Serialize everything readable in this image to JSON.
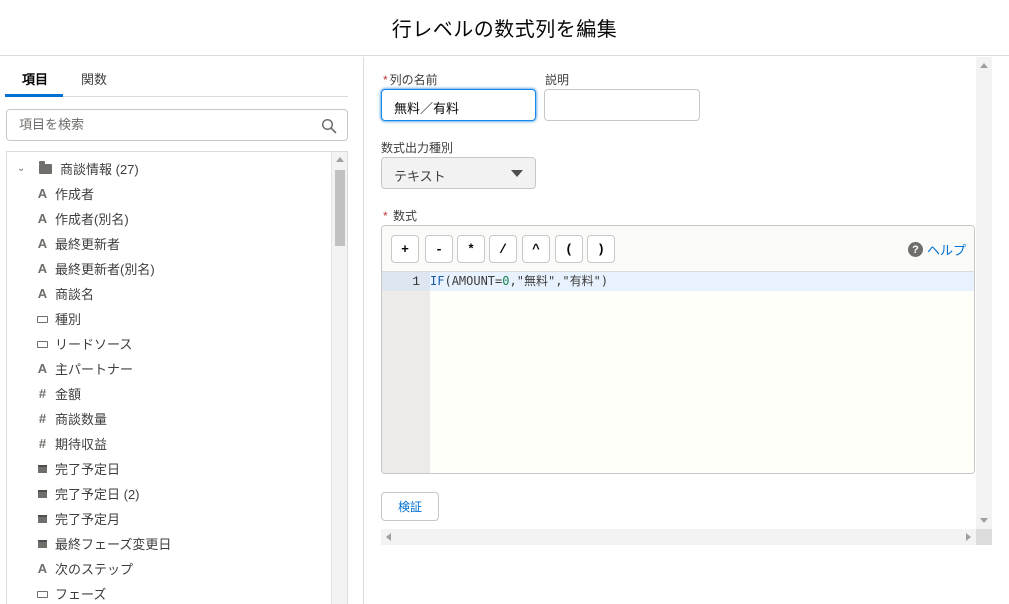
{
  "header": {
    "title": "行レベルの数式列を編集"
  },
  "tabs": [
    {
      "label": "項目",
      "active": true
    },
    {
      "label": "関数",
      "active": false
    }
  ],
  "search": {
    "placeholder": "項目を検索"
  },
  "tree": {
    "parent": {
      "label": "商談情報 (27)",
      "expanded": true
    },
    "items": [
      {
        "label": "作成者",
        "icon": "text-icon"
      },
      {
        "label": "作成者(別名)",
        "icon": "text-icon"
      },
      {
        "label": "最終更新者",
        "icon": "text-icon"
      },
      {
        "label": "最終更新者(別名)",
        "icon": "text-icon"
      },
      {
        "label": "商談名",
        "icon": "text-icon"
      },
      {
        "label": "種別",
        "icon": "picklist-icon"
      },
      {
        "label": "リードソース",
        "icon": "picklist-icon"
      },
      {
        "label": "主パートナー",
        "icon": "text-icon"
      },
      {
        "label": "金額",
        "icon": "number-icon"
      },
      {
        "label": "商談数量",
        "icon": "number-icon"
      },
      {
        "label": "期待収益",
        "icon": "number-icon"
      },
      {
        "label": "完了予定日",
        "icon": "date-icon"
      },
      {
        "label": "完了予定日 (2)",
        "icon": "date-icon"
      },
      {
        "label": "完了予定月",
        "icon": "date-icon"
      },
      {
        "label": "最終フェーズ変更日",
        "icon": "date-icon"
      },
      {
        "label": "次のステップ",
        "icon": "text-icon"
      },
      {
        "label": "フェーズ",
        "icon": "picklist-icon"
      }
    ]
  },
  "form": {
    "column_name_label": "列の名前",
    "column_name_value": "無料／有料",
    "description_label": "説明",
    "description_value": "",
    "output_type_label": "数式出力種別",
    "output_type_value": "テキスト",
    "formula_label": "数式",
    "required_mark": "*"
  },
  "editor": {
    "operators": [
      "+",
      "-",
      "*",
      "/",
      "^",
      "(",
      ")"
    ],
    "help_label": "ヘルプ",
    "line_number": "1",
    "code": {
      "func": "IF",
      "open": "(",
      "field": "AMOUNT",
      "eq": "=",
      "zero": "0",
      "rest": ",\"無料\",\"有料\")"
    }
  },
  "validate_label": "検証"
}
